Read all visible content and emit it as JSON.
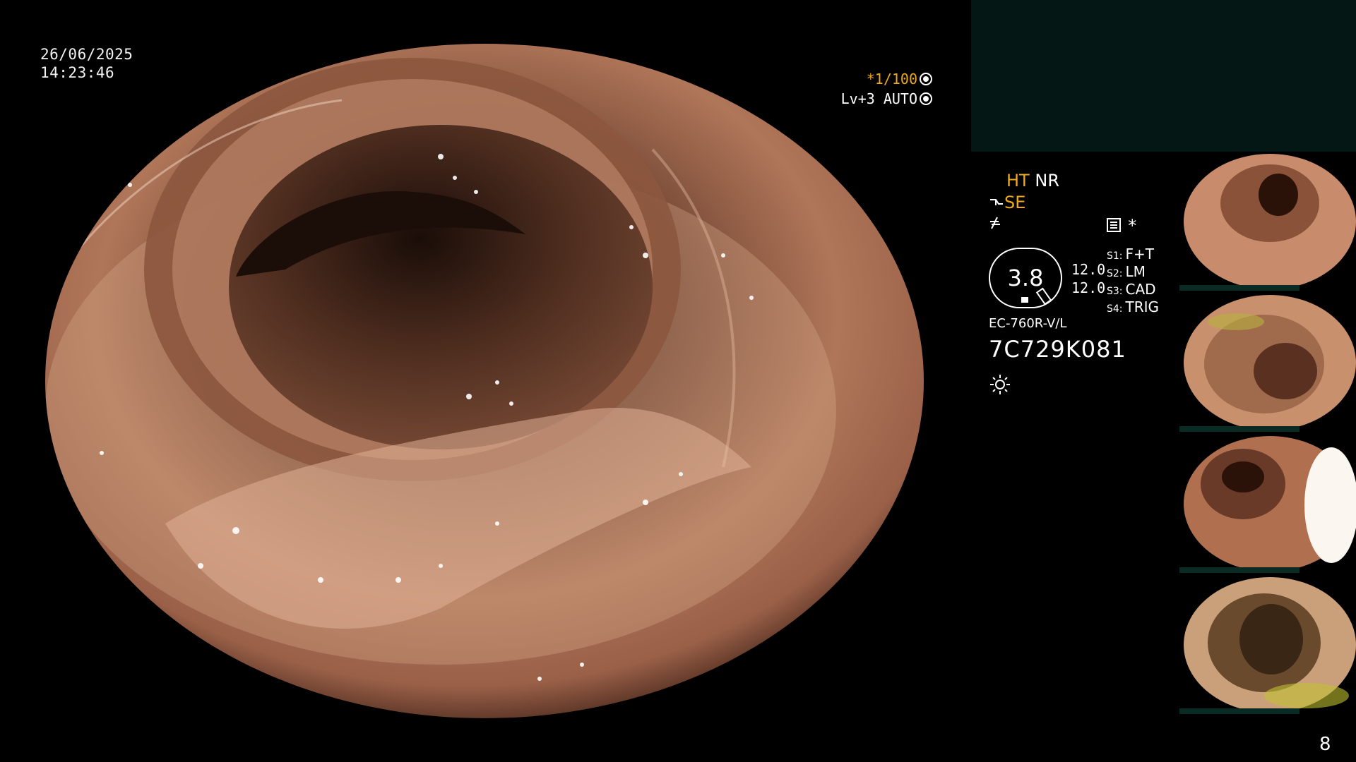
{
  "screen": {
    "date": "26/06/2025",
    "time": "14:23:46",
    "shutter_speed": "*1/100",
    "exposure": "Lv+3 AUTO",
    "modes": {
      "ht": "HT",
      "nr": "NR",
      "se": "SE"
    },
    "gauge_value": "3.8",
    "scale_values": [
      "12.0",
      "12.0"
    ],
    "presets": [
      {
        "key": "S1:",
        "value": "F+T"
      },
      {
        "key": "S2:",
        "value": "LM"
      },
      {
        "key": "S3:",
        "value": "CAD"
      },
      {
        "key": "S4:",
        "value": "TRIG"
      }
    ],
    "scope_model": "EC-760R-V/L",
    "scope_serial": "7C729K081",
    "page_number": "8"
  },
  "colors": {
    "accent_orange": "#f0a818",
    "info_box": "#041715",
    "mucosa": "#b87a5e"
  },
  "icons": {
    "shutter": "aperture-icon",
    "exposure": "ring-icon",
    "mode1": "probe-icon",
    "mode2": "freeze-icon",
    "light": "light-source-icon",
    "record": "record-icon"
  }
}
